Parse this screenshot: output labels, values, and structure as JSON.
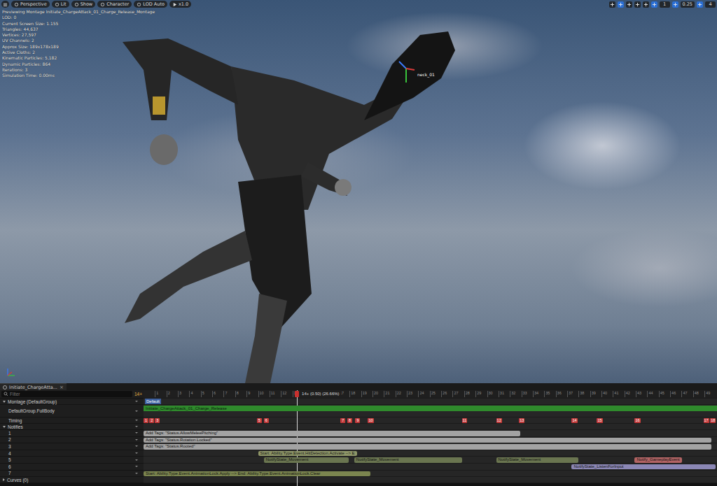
{
  "viewport": {
    "toolbar": {
      "left": [
        "Perspective",
        "Lit",
        "Show",
        "Character",
        "LOD Auto",
        "x1.0"
      ],
      "right": [
        {
          "kind": "icon",
          "active": false
        },
        {
          "kind": "icon",
          "active": true
        },
        {
          "kind": "icon",
          "active": false
        },
        {
          "kind": "icon",
          "active": false
        },
        {
          "kind": "icon",
          "active": false
        },
        {
          "kind": "icon",
          "active": true
        },
        {
          "kind": "value",
          "label": "1",
          "active": false
        },
        {
          "kind": "icon",
          "active": true
        },
        {
          "kind": "value",
          "label": "0.25",
          "active": false
        },
        {
          "kind": "icon",
          "active": true
        },
        {
          "kind": "value",
          "label": "4",
          "active": false
        }
      ]
    },
    "stats": [
      "Previewing Montage Initiate_ChargeAttack_01_Charge_Release_Montage",
      "LOD: 0",
      "Current Screen Size: 1.155",
      "Triangles: 44,637",
      "Vertices: 27,597",
      "UV Channels: 2",
      "Approx Size: 189x178x189",
      "Active Cloths: 2",
      "Kinematic Particles: 5,182",
      "Dynamic Particles: 864",
      "Iterations: 3",
      "Simulation Time: 0.00ms"
    ],
    "bone_label": "neck_01"
  },
  "editor": {
    "tab": {
      "label": "Initiate_ChargeAtta...",
      "close": "×"
    },
    "filter": {
      "placeholder": "Filter"
    },
    "frame_field": "14+",
    "ruler": [
      "1",
      "2",
      "3",
      "4",
      "5",
      "6",
      "7",
      "8",
      "9",
      "10",
      "11",
      "12",
      "13",
      "14",
      "15",
      "16",
      "17",
      "18",
      "19",
      "20",
      "21",
      "22",
      "23",
      "24",
      "25",
      "26",
      "27",
      "28",
      "29",
      "30",
      "31",
      "32",
      "33",
      "34",
      "35",
      "36",
      "37",
      "38",
      "39",
      "40",
      "41",
      "42",
      "43",
      "44",
      "45",
      "46",
      "47",
      "48",
      "49"
    ],
    "playhead": {
      "frame": 13.4,
      "label": "14+ (0.50) (26.66%)"
    },
    "montage": {
      "label": "Montage (DefaultGroup)",
      "expanded": true,
      "section": "Default"
    },
    "slot": {
      "label": "DefaultGroup.FullBody",
      "segment": "Initiate_ChargeAttack_01_Charge_Release"
    },
    "timing": {
      "label": "Timing",
      "markers": [
        {
          "label": "1",
          "frame": 0
        },
        {
          "label": "2",
          "frame": 0.5
        },
        {
          "label": "3",
          "frame": 1.0
        },
        {
          "label": "5",
          "frame": 9.9
        },
        {
          "label": "6",
          "frame": 10.5
        },
        {
          "label": "7",
          "frame": 17.2
        },
        {
          "label": "8",
          "frame": 17.8
        },
        {
          "label": "9",
          "frame": 18.5
        },
        {
          "label": "10",
          "frame": 19.6
        },
        {
          "label": "11",
          "frame": 27.8
        },
        {
          "label": "12",
          "frame": 30.8
        },
        {
          "label": "13",
          "frame": 32.8
        },
        {
          "label": "14",
          "frame": 37.4
        },
        {
          "label": "15",
          "frame": 39.6
        },
        {
          "label": "16",
          "frame": 42.9
        },
        {
          "label": "17",
          "frame": 48.9
        },
        {
          "label": "18",
          "frame": 49.5
        }
      ]
    },
    "notifies": {
      "label": "Notifies",
      "expanded": true,
      "tracks": [
        {
          "label": "1",
          "bars": [
            {
              "text": "Add Tags: \"Status.AllowMeleePitching\"",
              "start": 0,
              "end": 32.9,
              "color": "#a3a3a3"
            }
          ]
        },
        {
          "label": "2",
          "bars": [
            {
              "text": "Add Tags: \"Status.Rotation.Locked\"",
              "start": 0,
              "end": 49.6,
              "color": "#a3a3a3"
            }
          ]
        },
        {
          "label": "3",
          "bars": [
            {
              "text": "Add Tags: \"Status.Rooted\"",
              "start": 0,
              "end": 49.6,
              "color": "#a3a3a3"
            }
          ]
        },
        {
          "label": "4",
          "bars": [
            {
              "text": "Start: Ability.Type.Event.HitDetection.Activate --> E",
              "start": 10.0,
              "end": 17.3,
              "color": "#8e9668"
            }
          ]
        },
        {
          "label": "5",
          "bars": [
            {
              "text": "NotifyState_Movement",
              "start": 10.5,
              "end": 17.9,
              "color": "#6a7550"
            },
            {
              "text": "NotifyState_Movement",
              "start": 18.4,
              "end": 27.8,
              "color": "#6a7550"
            },
            {
              "text": "NotifyState_Movement",
              "start": 30.8,
              "end": 38.0,
              "color": "#6a7550"
            },
            {
              "text": "Notify_GameplayEvent",
              "start": 42.9,
              "end": 46.4,
              "color": "#b26464"
            }
          ]
        },
        {
          "label": "6",
          "bars": [
            {
              "text": "NotifyState_ListenForInput",
              "start": 37.4,
              "end": 50,
              "color": "#8b87b5"
            }
          ]
        },
        {
          "label": "7",
          "bars": [
            {
              "text": "Start: Ability.Type.Event.AnimationLock.Apply --> End: Ability.Type.Event.AnimationLock.Clear",
              "start": 0,
              "end": 19.8,
              "color": "#7b854f"
            }
          ]
        }
      ]
    },
    "curves": {
      "label": "Curves (0)"
    }
  }
}
